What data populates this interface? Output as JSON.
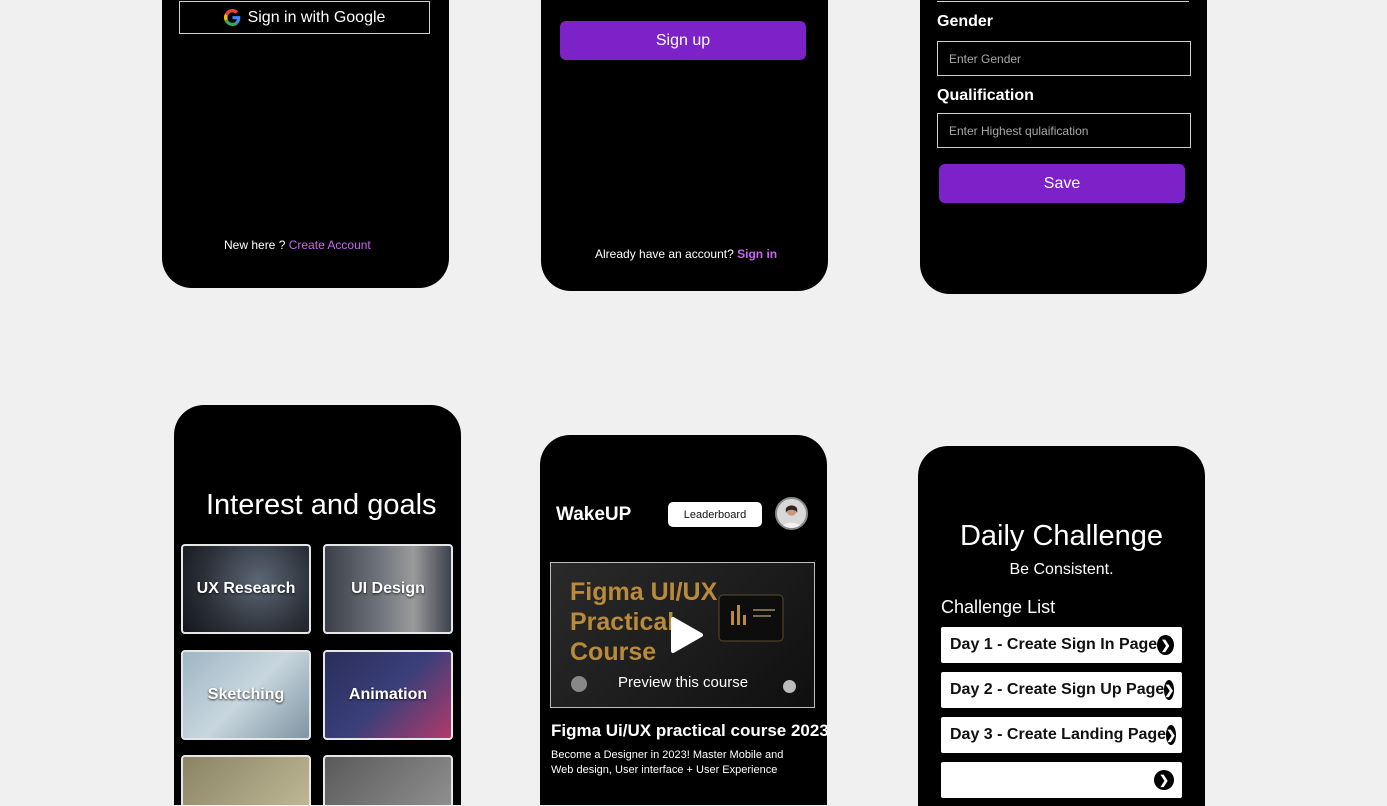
{
  "signin_screen": {
    "google_button": "Sign in with Google",
    "new_here": "New here ?",
    "create_account": "Create Account"
  },
  "signup_screen": {
    "signup_button": "Sign up",
    "already": "Already have an account?",
    "signin_link": "Sign in"
  },
  "profile_screen": {
    "gender_label": "Gender",
    "gender_placeholder": "Enter Gender",
    "qualification_label": "Qualification",
    "qualification_placeholder": "Enter Highest qulaification",
    "save_button": "Save"
  },
  "interests_screen": {
    "title": "Interest and goals",
    "tiles": [
      {
        "label": "UX Research"
      },
      {
        "label": "UI Design"
      },
      {
        "label": "Sketching"
      },
      {
        "label": "Animation"
      },
      {
        "label": ""
      },
      {
        "label": ""
      }
    ]
  },
  "course_screen": {
    "brand": "WakeUP",
    "leaderboard_button": "Leaderboard",
    "video_title_line1": "Figma UI/UX",
    "video_title_line2": "Practical",
    "video_title_line3": "Course",
    "preview_label": "Preview this course",
    "course_title": "Figma Ui/UX practical course 2023",
    "course_desc": "Become a Designer in 2023! Master Mobile and Web design, User interface + User Experience"
  },
  "challenge_screen": {
    "title": "Daily Challenge",
    "subtitle": "Be Consistent.",
    "list_label": "Challenge List",
    "items": [
      {
        "label": "Day 1 - Create Sign In Page"
      },
      {
        "label": "Day 2 - Create Sign Up Page"
      },
      {
        "label": "Day 3 - Create Landing Page"
      },
      {
        "label": ""
      }
    ]
  },
  "colors": {
    "page_bg": "#f1f0f0",
    "phone_bg": "#000000",
    "accent_purple": "#7d22c8",
    "link_purple": "#c767f0",
    "course_gold": "#b88a3a"
  },
  "icons": [
    "google-icon",
    "play-icon",
    "chevron-right-icon",
    "avatar"
  ]
}
